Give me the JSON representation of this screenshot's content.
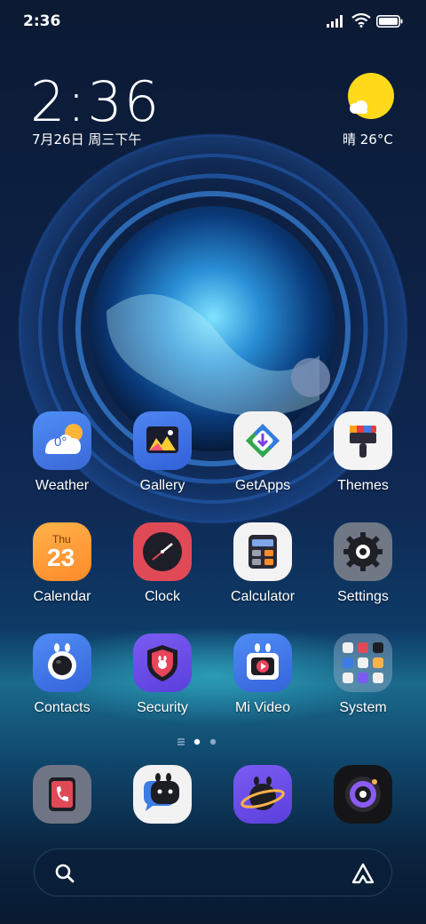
{
  "status_bar": {
    "time": "2:36",
    "icons": [
      "signal-icon",
      "wifi-icon",
      "battery-icon"
    ]
  },
  "clock_widget": {
    "time": "2:36",
    "date": "7月26日 周三下午",
    "weather": "晴 26°C",
    "weather_icon": "sun-icon"
  },
  "apps": [
    {
      "label": "Weather",
      "icon": "weather-icon",
      "icon_text": "0°"
    },
    {
      "label": "Gallery",
      "icon": "gallery-icon"
    },
    {
      "label": "GetApps",
      "icon": "getapps-icon"
    },
    {
      "label": "Themes",
      "icon": "themes-icon"
    },
    {
      "label": "Calendar",
      "icon": "calendar-icon",
      "icon_text": "23",
      "icon_subtext": "Thu"
    },
    {
      "label": "Clock",
      "icon": "clock-icon"
    },
    {
      "label": "Calculator",
      "icon": "calculator-icon"
    },
    {
      "label": "Settings",
      "icon": "settings-icon"
    },
    {
      "label": "Contacts",
      "icon": "contacts-icon"
    },
    {
      "label": "Security",
      "icon": "security-icon"
    },
    {
      "label": "Mi Video",
      "icon": "mi-video-icon"
    },
    {
      "label": "System",
      "icon": "system-folder-icon"
    }
  ],
  "page_indicator": {
    "pages": 2,
    "current": 1
  },
  "dock": [
    {
      "icon": "phone-icon"
    },
    {
      "icon": "messages-icon"
    },
    {
      "icon": "browser-icon"
    },
    {
      "icon": "camera-icon"
    }
  ],
  "search_bar": {
    "left_icon": "search-icon",
    "right_icon": "assistant-icon"
  },
  "colors": {
    "sun": "#ffd91a",
    "accent_blue": "#3f6fe8"
  }
}
